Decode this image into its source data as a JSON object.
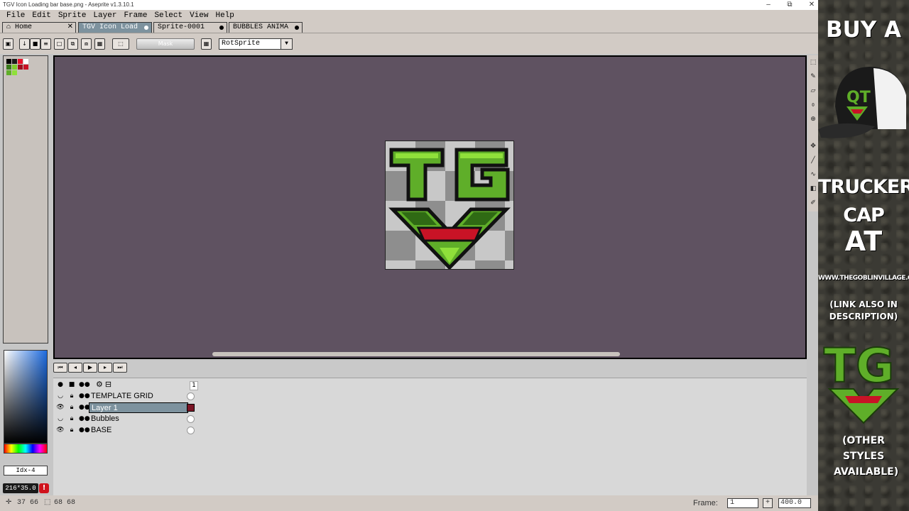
{
  "window": {
    "title": "TGV Icon Loading bar base.png - Aseprite v1.3.10.1",
    "minimize": "–",
    "maximize": "⧉",
    "close": "✕"
  },
  "menu": [
    "File",
    "Edit",
    "Sprite",
    "Layer",
    "Frame",
    "Select",
    "View",
    "Help"
  ],
  "tabs": [
    {
      "label": "⌂ Home",
      "closable": true
    },
    {
      "label": "TGV Icon Load",
      "active": true
    },
    {
      "label": "Sprite-0001"
    },
    {
      "label": "BUBBLES ANIMA"
    }
  ],
  "context_bar": {
    "mask_label": "Mask",
    "rotation_algorithm": "RotSprite"
  },
  "palette": {
    "index_label": "Idx-4",
    "rgb_label": "216*35.0",
    "warning": "!",
    "colors": [
      "#000000",
      "#1a1a1a",
      "#e8132b",
      "#ffffff",
      "#3a7a1c",
      "#7ecb2a",
      "#9d0f1e",
      "#c81326",
      "#5fae29",
      "#8fe03a"
    ]
  },
  "timeline": {
    "frame_number": "1",
    "layers": [
      {
        "name": "TEMPLATE GRID",
        "visible": false,
        "selected": false
      },
      {
        "name": "Layer 1",
        "visible": true,
        "selected": true
      },
      {
        "name": "Bubbles",
        "visible": false,
        "selected": false
      },
      {
        "name": "BASE",
        "visible": true,
        "selected": false
      }
    ]
  },
  "status": {
    "position": "37 66",
    "size": "68 68",
    "frame_label": "Frame:",
    "frame_value": "1",
    "zoom": "400.0"
  },
  "sprite": {
    "letters": "TG",
    "colors": {
      "green": "#5fae29",
      "light_green": "#8fe03a",
      "dark_green": "#2f6a14",
      "red": "#c81326",
      "outline": "#111111"
    }
  },
  "ad": {
    "line1": "BUY A",
    "line2": "TRUCKER CAP",
    "line3": "AT",
    "url": "WWW.THEGOBLINVILLAGE.COM",
    "note": "(LINK ALSO IN DESCRIPTION)",
    "other": "(OTHER STYLES AVAILABLE)"
  }
}
